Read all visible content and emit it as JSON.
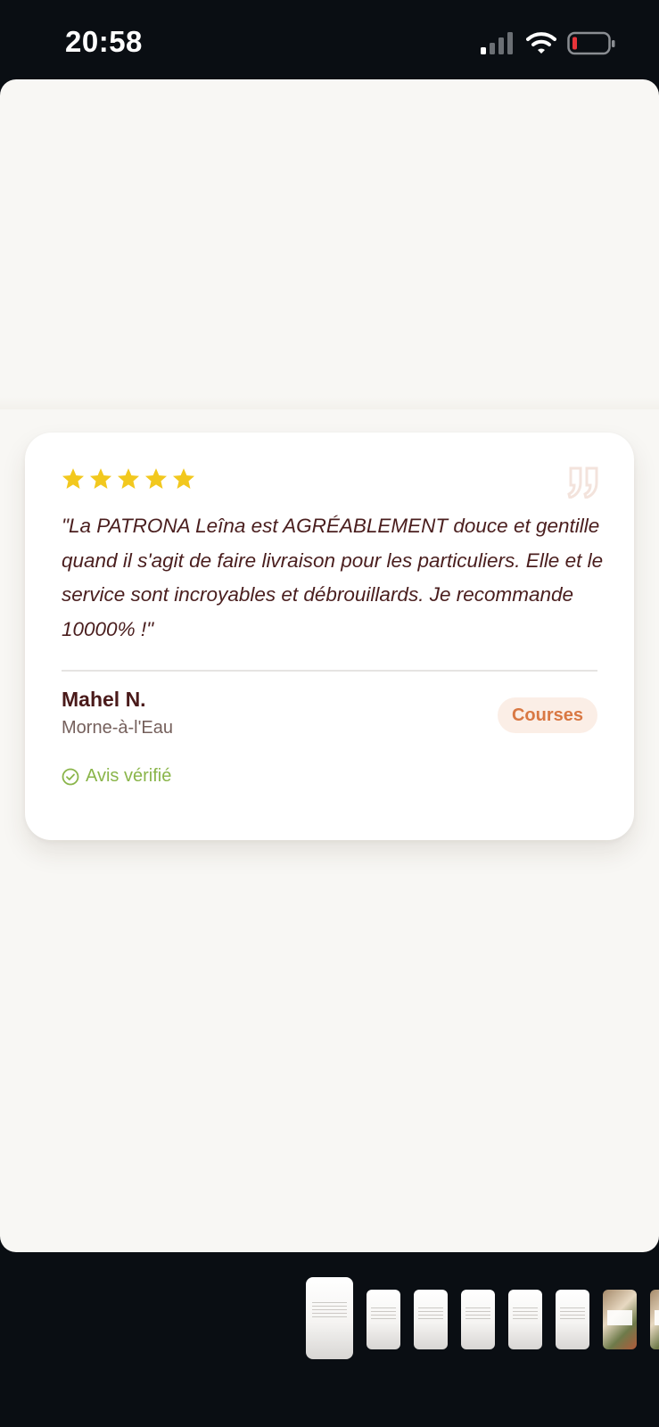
{
  "status_bar": {
    "time": "20:58",
    "icons": [
      "signal-icon",
      "wifi-icon",
      "battery-icon"
    ],
    "battery_level": "low"
  },
  "review": {
    "rating": 5,
    "max_rating": 5,
    "star_color": "#f2c81e",
    "text": "\"La PATRONA Leîna est AGRÉABLEMENT douce et gentille quand il s'agit de faire livraison pour les particuliers. Elle et le service sont incroyables et débrouillards. Je recommande 10000% !\"",
    "author": "Mahel N.",
    "location": "Morne-à-l'Eau",
    "category": "Courses",
    "verified_label": "Avis vérifié"
  },
  "colors": {
    "text_primary": "#4a1e1e",
    "badge_text": "#d97843",
    "badge_bg": "#fbeee6",
    "verified": "#8ab54a"
  },
  "thumbnails": {
    "count": 8,
    "selected_index": 0
  }
}
